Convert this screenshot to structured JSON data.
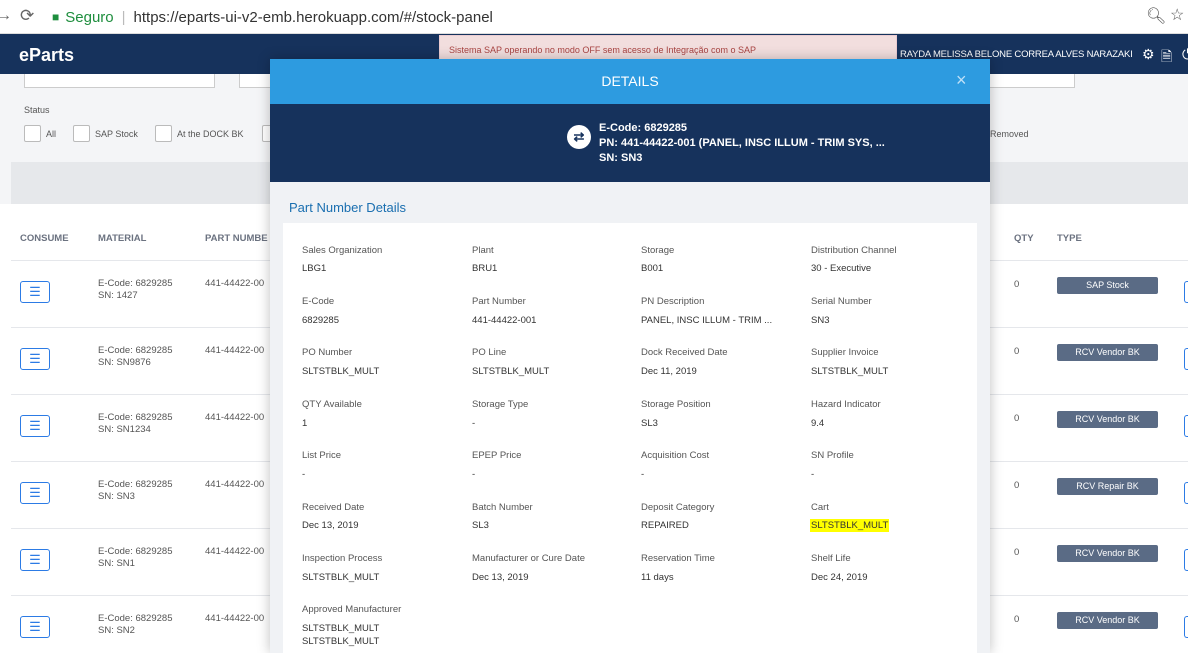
{
  "browser": {
    "secure_label": "Seguro",
    "url": "https://eparts-ui-v2-emb.herokuapp.com/#/stock-panel"
  },
  "header": {
    "logo": "eParts",
    "user": "RAYDA MELISSA BELONE CORREA ALVES NARAZAKI",
    "sap_banner": "Sistema SAP operando no modo OFF sem acesso de Integração com o SAP"
  },
  "filters": {
    "status_label": "Status",
    "options": [
      "All",
      "SAP Stock",
      "At the DOCK BK",
      "Removed"
    ]
  },
  "table": {
    "columns": [
      "CONSUME",
      "MATERIAL",
      "PART NUMBE",
      "QTY",
      "TYPE"
    ],
    "rows": [
      {
        "ecode": "E-Code: 6829285",
        "sn": "SN: 1427",
        "pn": "441-44422-00",
        "qty": "0",
        "type": "SAP Stock"
      },
      {
        "ecode": "E-Code: 6829285",
        "sn": "SN: SN9876",
        "pn": "441-44422-00",
        "qty": "0",
        "type": "RCV Vendor BK"
      },
      {
        "ecode": "E-Code: 6829285",
        "sn": "SN: SN1234",
        "pn": "441-44422-00",
        "qty": "0",
        "type": "RCV Vendor BK"
      },
      {
        "ecode": "E-Code: 6829285",
        "sn": "SN: SN3",
        "pn": "441-44422-00",
        "qty": "0",
        "type": "RCV Repair BK"
      },
      {
        "ecode": "E-Code: 6829285",
        "sn": "SN: SN1",
        "pn": "441-44422-00",
        "qty": "0",
        "type": "RCV Vendor BK"
      },
      {
        "ecode": "E-Code: 6829285",
        "sn": "SN: SN2",
        "pn": "441-44422-00",
        "qty": "0",
        "type": "RCV Vendor BK"
      }
    ]
  },
  "modal": {
    "title": "DETAILS",
    "close": "×",
    "ecode": "E-Code: 6829285",
    "pn": "PN: 441-44422-001 (PANEL, INSC ILLUM - TRIM SYS, ...",
    "sn": "SN: SN3",
    "section_title": "Part Number Details",
    "fields": [
      {
        "label": "Sales Organization",
        "value": "LBG1"
      },
      {
        "label": "Plant",
        "value": "BRU1"
      },
      {
        "label": "Storage",
        "value": "B001"
      },
      {
        "label": "Distribution Channel",
        "value": "30 - Executive"
      },
      {
        "label": "E-Code",
        "value": "6829285"
      },
      {
        "label": "Part Number",
        "value": "441-44422-001"
      },
      {
        "label": "PN Description",
        "value": "PANEL, INSC ILLUM - TRIM ..."
      },
      {
        "label": "Serial Number",
        "value": "SN3"
      },
      {
        "label": "PO Number",
        "value": "SLTSTBLK_MULT"
      },
      {
        "label": "PO Line",
        "value": "SLTSTBLK_MULT"
      },
      {
        "label": "Dock Received Date",
        "value": "Dec 11, 2019"
      },
      {
        "label": "Supplier Invoice",
        "value": "SLTSTBLK_MULT"
      },
      {
        "label": "QTY Available",
        "value": "1"
      },
      {
        "label": "Storage Type",
        "value": "-"
      },
      {
        "label": "Storage Position",
        "value": "SL3"
      },
      {
        "label": "Hazard Indicator",
        "value": "9.4"
      },
      {
        "label": "List Price",
        "value": "-"
      },
      {
        "label": "EPEP Price",
        "value": "-"
      },
      {
        "label": "Acquisition Cost",
        "value": "-"
      },
      {
        "label": "SN Profile",
        "value": "-"
      },
      {
        "label": "Received Date",
        "value": "Dec 13, 2019"
      },
      {
        "label": "Batch Number",
        "value": "SL3"
      },
      {
        "label": "Deposit Category",
        "value": "REPAIRED"
      },
      {
        "label": "Cart",
        "value": "SLTSTBLK_MULT"
      },
      {
        "label": "Inspection Process",
        "value": "SLTSTBLK_MULT"
      },
      {
        "label": "Manufacturer or Cure Date",
        "value": "Dec 13, 2019"
      },
      {
        "label": "Reservation Time",
        "value": "11 days"
      },
      {
        "label": "Shelf Life",
        "value": "Dec 24, 2019"
      },
      {
        "label": "Approved Manufacturer",
        "value": "SLTSTBLK_MULT"
      },
      {
        "label": "",
        "value": "SLTSTBLK_MULT"
      }
    ]
  },
  "colors": {
    "header_bg": "#16325c",
    "modal_head_bg": "#2d9be0",
    "highlight": "#ffff00",
    "badge_bg": "#5a6b85"
  },
  "icons": [
    "back-icon",
    "reload-icon",
    "lock-icon",
    "zoom-icon",
    "star-icon",
    "gear-icon",
    "document-icon",
    "list-icon",
    "swap-icon",
    "close-icon"
  ]
}
